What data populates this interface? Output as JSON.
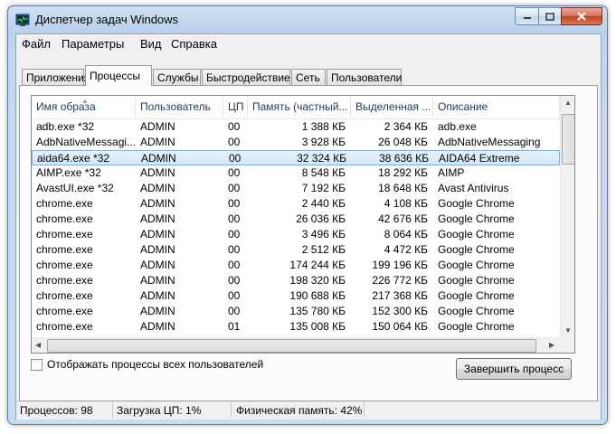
{
  "window": {
    "title": "Диспетчер задач Windows"
  },
  "menu": [
    "Файл",
    "Параметры",
    "Вид",
    "Справка"
  ],
  "tabs": [
    "Приложения",
    "Процессы",
    "Службы",
    "Быстродействие",
    "Сеть",
    "Пользователи"
  ],
  "active_tab": "Процессы",
  "columns": [
    "Имя образа",
    "Пользователь",
    "ЦП",
    "Память (частный...",
    "Выделенная ...",
    "Описание"
  ],
  "processes": [
    [
      "adb.exe *32",
      "ADMIN",
      "00",
      "1 388 КБ",
      "2 364 КБ",
      "adb.exe"
    ],
    [
      "AdbNativeMessagi...",
      "ADMIN",
      "00",
      "3 928 КБ",
      "26 048 КБ",
      "AdbNativeMessaging"
    ],
    [
      "aida64.exe *32",
      "ADMIN",
      "00",
      "32 324 КБ",
      "38 636 КБ",
      "AIDA64 Extreme"
    ],
    [
      "AIMP.exe *32",
      "ADMIN",
      "00",
      "8 548 КБ",
      "18 292 КБ",
      "AIMP"
    ],
    [
      "AvastUI.exe *32",
      "ADMIN",
      "00",
      "7 192 КБ",
      "18 648 КБ",
      "Avast Antivirus"
    ],
    [
      "chrome.exe",
      "ADMIN",
      "00",
      "2 440 КБ",
      "4 108 КБ",
      "Google Chrome"
    ],
    [
      "chrome.exe",
      "ADMIN",
      "00",
      "26 036 КБ",
      "42 676 КБ",
      "Google Chrome"
    ],
    [
      "chrome.exe",
      "ADMIN",
      "00",
      "3 496 КБ",
      "8 064 КБ",
      "Google Chrome"
    ],
    [
      "chrome.exe",
      "ADMIN",
      "00",
      "2 512 КБ",
      "4 472 КБ",
      "Google Chrome"
    ],
    [
      "chrome.exe",
      "ADMIN",
      "00",
      "174 244 КБ",
      "199 196 КБ",
      "Google Chrome"
    ],
    [
      "chrome.exe",
      "ADMIN",
      "00",
      "198 320 КБ",
      "226 772 КБ",
      "Google Chrome"
    ],
    [
      "chrome.exe",
      "ADMIN",
      "00",
      "190 688 КБ",
      "217 368 КБ",
      "Google Chrome"
    ],
    [
      "chrome.exe",
      "ADMIN",
      "00",
      "135 780 КБ",
      "152 300 КБ",
      "Google Chrome"
    ],
    [
      "chrome.exe",
      "ADMIN",
      "01",
      "135 008 КБ",
      "150 064 КБ",
      "Google Chrome"
    ]
  ],
  "selected_row": 2,
  "show_all_label": "Отображать процессы всех пользователей",
  "show_all_checked": false,
  "end_process_label": "Завершить процесс",
  "status": {
    "processes": "Процессов: 98",
    "cpu": "Загрузка ЦП: 1%",
    "memory": "Физическая память: 42%"
  },
  "colors": {
    "highlight_line": "#d4161d",
    "selection": "#d2e7fa"
  }
}
